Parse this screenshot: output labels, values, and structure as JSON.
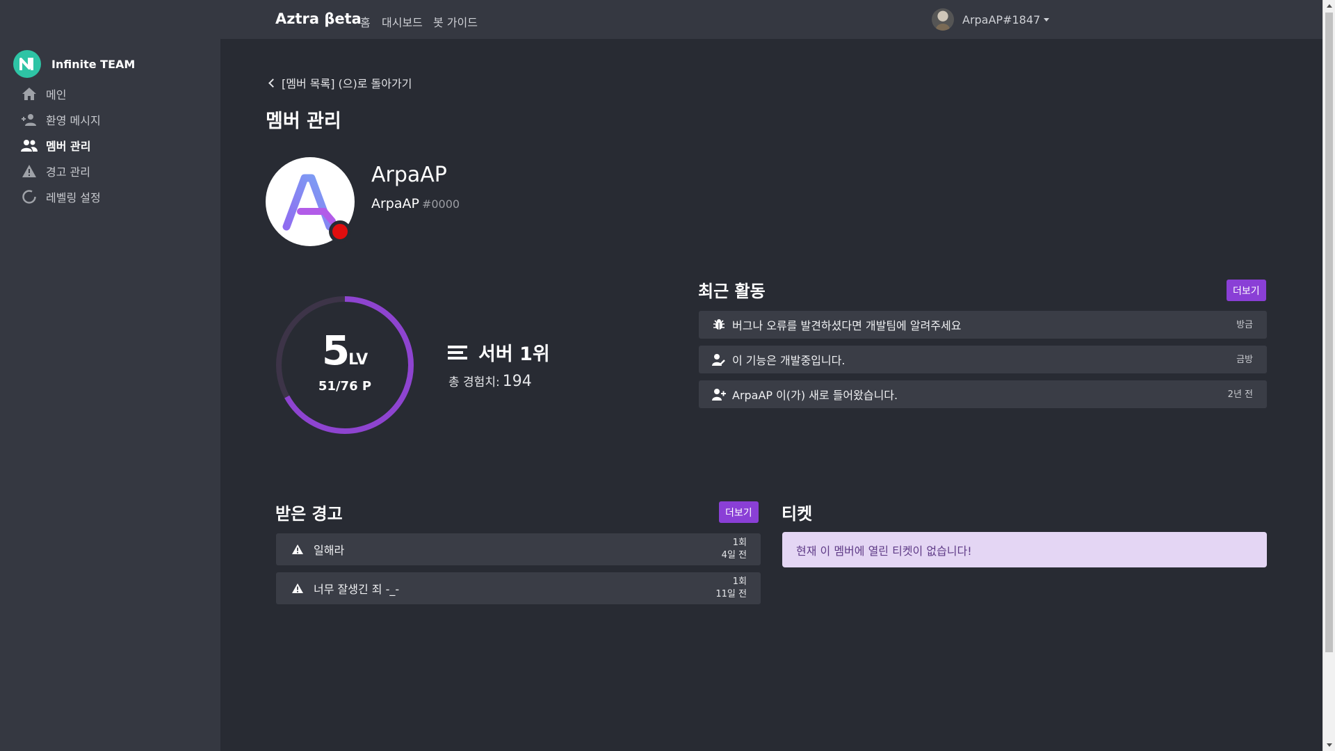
{
  "navbar": {
    "brand": "Aztra βeta",
    "links": [
      "홈",
      "대시보드",
      "봇 가이드"
    ],
    "user": "ArpaAP#1847"
  },
  "sidebar": {
    "server_name": "Infinite TEAM",
    "server_icon": "infinite-team-logo",
    "items": [
      {
        "label": "메인",
        "icon": "home-icon",
        "active": false
      },
      {
        "label": "환영 메시지",
        "icon": "person-add-icon",
        "active": false
      },
      {
        "label": "멤버 관리",
        "icon": "people-icon",
        "active": true
      },
      {
        "label": "경고 관리",
        "icon": "warning-icon",
        "active": false
      },
      {
        "label": "레벨링 설정",
        "icon": "progress-circle-icon",
        "active": false
      }
    ]
  },
  "main": {
    "back_link": "[멤버 목록] (으)로 돌아가기",
    "title": "멤버 관리",
    "member": {
      "display_name": "ArpaAP",
      "username": "ArpaAP",
      "discriminator": "#0000",
      "status_color": "#e00e0e"
    },
    "level": {
      "level": "5",
      "level_suffix": "LV",
      "exp_text": "51/76 P",
      "progress": 0.67,
      "ring_color": "#8e44d0",
      "rank_text": "서버 1위",
      "total_exp_label": "총 경험치:",
      "total_exp": "194"
    },
    "recent_activity": {
      "title": "최근 활동",
      "more_label": "더보기",
      "items": [
        {
          "icon": "bug-icon",
          "text": "버그나 오류를 발견하셨다면 개발팀에 알려주세요",
          "time": "방금"
        },
        {
          "icon": "person-edit-icon",
          "text": "이 기능은 개발중입니다.",
          "time": "금방"
        },
        {
          "icon": "person-add-icon",
          "text": "ArpaAP 이(가) 새로 들어왔습니다.",
          "time": "2년 전"
        }
      ]
    },
    "warnings": {
      "title": "받은 경고",
      "more_label": "더보기",
      "items": [
        {
          "text": "일해라",
          "count": "1회",
          "time": "4일 전"
        },
        {
          "text": "너무 잘생긴 죄 -_-",
          "count": "1회",
          "time": "11일 전"
        }
      ]
    },
    "tickets": {
      "title": "티켓",
      "empty_text": "현재 이 멤버에 열린 티켓이 없습니다!"
    },
    "accent_color": "#8a3fd6"
  }
}
